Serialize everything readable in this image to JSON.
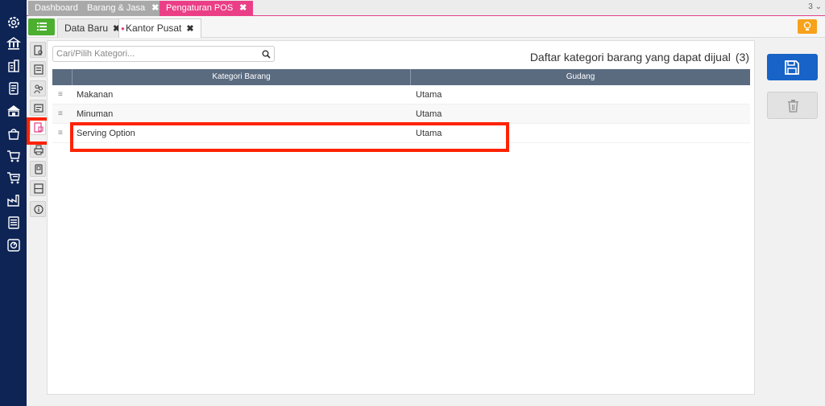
{
  "left_nav": {
    "icons": [
      "gear-icon",
      "bank-icon",
      "building-icon",
      "document-icon",
      "institution-icon",
      "bag-icon",
      "cart-icon",
      "cart-list-icon",
      "factory-icon",
      "report-icon",
      "dashboard-icon"
    ]
  },
  "top_tabs": [
    {
      "label": "Dashboard",
      "closable": false
    },
    {
      "label": "Barang & Jasa",
      "close": "✖"
    },
    {
      "label": "Pengaturan POS",
      "close": "✖",
      "active": true
    }
  ],
  "tab_count": "3",
  "sub_tabs": [
    {
      "label": "Data Baru",
      "close": "✖"
    },
    {
      "label": "Kantor Pusat",
      "close": "✖",
      "active": true
    }
  ],
  "search": {
    "placeholder": "Cari/Pilih Kategori..."
  },
  "panel": {
    "title": "Daftar kategori barang yang dapat dijual",
    "count": "(3)"
  },
  "table": {
    "columns": [
      "Kategori Barang",
      "Gudang"
    ],
    "rows": [
      {
        "drag": "≡",
        "kategori": "Makanan",
        "gudang": "Utama"
      },
      {
        "drag": "≡",
        "kategori": "Minuman",
        "gudang": "Utama"
      },
      {
        "drag": "≡",
        "kategori": "Serving Option",
        "gudang": "Utama"
      }
    ]
  },
  "colors": {
    "nav_bg": "#0d2455",
    "active_tab": "#ea3f86",
    "menu_button": "#4caf2f",
    "save_button": "#1763c7",
    "highlight": "#ff2200",
    "bulb_button": "#f7a21b"
  }
}
